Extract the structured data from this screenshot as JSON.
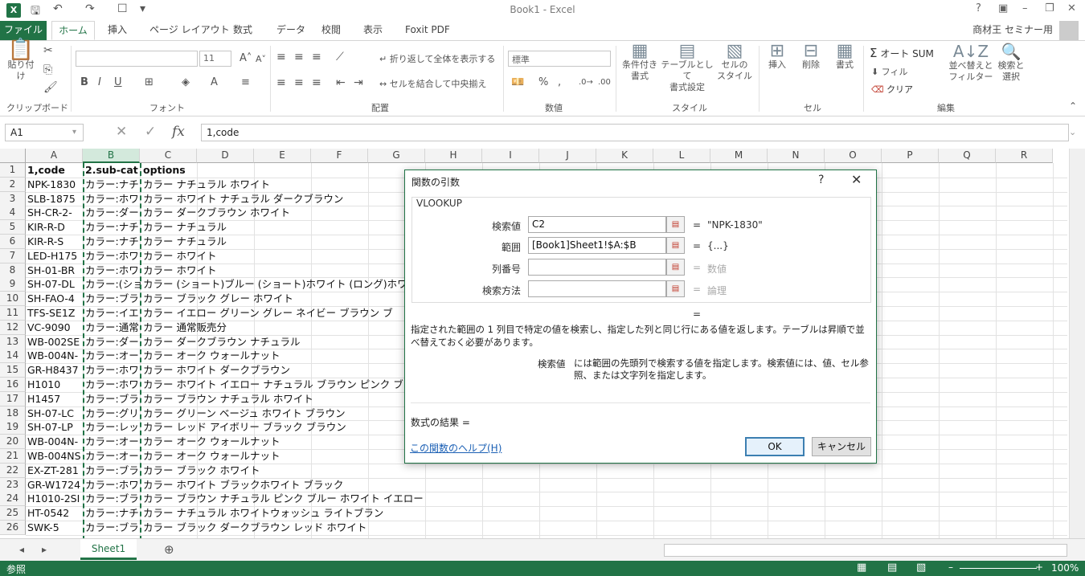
{
  "window": {
    "title": "Book1 - Excel",
    "logo": "X"
  },
  "tabs": [
    "ファイル",
    "ホーム",
    "挿入",
    "ページ レイアウト",
    "数式",
    "データ",
    "校閲",
    "表示",
    "Foxit PDF"
  ],
  "user": "商材王 セミナー用",
  "ribbon": {
    "groups": [
      "クリップボード",
      "フォント",
      "配置",
      "数値",
      "スタイル",
      "セル",
      "編集"
    ],
    "paste": "貼り付け",
    "font_size": "11",
    "wrap_text": "折り返して全体を表示する",
    "merge_center": "セルを結合して中央揃え",
    "number_format": "標準",
    "conditional_format": [
      "条件付き",
      "書式"
    ],
    "format_table": [
      "テーブルとして",
      "書式設定"
    ],
    "cell_styles": [
      "セルの",
      "スタイル"
    ],
    "insert": "挿入",
    "delete": "削除",
    "format": "書式",
    "autosum": "オート SUM",
    "fill": "フィル",
    "clear": "クリア",
    "sort_filter": [
      "並べ替えと",
      "フィルター"
    ],
    "find_select": [
      "検索と",
      "選択"
    ]
  },
  "formula_bar": {
    "name_box": "A1",
    "formula": "1,code"
  },
  "columns": [
    "A",
    "B",
    "C",
    "D",
    "E",
    "F",
    "G",
    "H",
    "I",
    "J",
    "K",
    "L",
    "M",
    "N",
    "O",
    "P",
    "Q",
    "R"
  ],
  "rows": [
    {
      "n": "1",
      "a": "1,code",
      "b": "2.sub-cat",
      "c": "options"
    },
    {
      "n": "2",
      "a": "NPK-1830",
      "b": "カラー:ナチ",
      "c": "カラー ナチュラル ホワイト"
    },
    {
      "n": "3",
      "a": "SLB-1875",
      "b": "カラー:ホワ",
      "c": "カラー ホワイト ナチュラル ダークブラウン"
    },
    {
      "n": "4",
      "a": "SH-CR-2-",
      "b": "カラー:ダー",
      "c": "カラー ダークブラウン ホワイト"
    },
    {
      "n": "5",
      "a": "KIR-R-D",
      "b": "カラー:ナチ",
      "c": "カラー ナチュラル"
    },
    {
      "n": "6",
      "a": "KIR-R-S",
      "b": "カラー:ナチ",
      "c": "カラー ナチュラル"
    },
    {
      "n": "7",
      "a": "LED-H175",
      "b": "カラー:ホワ",
      "c": "カラー ホワイト"
    },
    {
      "n": "8",
      "a": "SH-01-BR",
      "b": "カラー:ホワ",
      "c": "カラー ホワイト"
    },
    {
      "n": "9",
      "a": "SH-07-DL",
      "b": "カラー:(ショ",
      "c": "カラー (ショート)ブルー (ショート)ホワイト (ロング)ホワ"
    },
    {
      "n": "10",
      "a": "SH-FAO-4",
      "b": "カラー:ブラ",
      "c": "カラー ブラック グレー ホワイト"
    },
    {
      "n": "11",
      "a": "TFS-SE1Z",
      "b": "カラー:イエ",
      "c": "カラー イエロー グリーン グレー ネイビー ブラウン ブ"
    },
    {
      "n": "12",
      "a": "VC-9090",
      "b": "カラー:通常",
      "c": "カラー 通常販売分"
    },
    {
      "n": "13",
      "a": "WB-002SE",
      "b": "カラー:ダー",
      "c": "カラー ダークブラウン ナチュラル"
    },
    {
      "n": "14",
      "a": "WB-004N-",
      "b": "カラー:オー",
      "c": "カラー オーク ウォールナット"
    },
    {
      "n": "15",
      "a": "GR-H8437",
      "b": "カラー:ホワ",
      "c": "カラー ホワイト ダークブラウン"
    },
    {
      "n": "16",
      "a": "H1010",
      "b": "カラー:ホワ",
      "c": "カラー ホワイト イエロー ナチュラル ブラウン ピンク ブ"
    },
    {
      "n": "17",
      "a": "H1457",
      "b": "カラー:ブラ",
      "c": "カラー ブラウン ナチュラル ホワイト"
    },
    {
      "n": "18",
      "a": "SH-07-LC",
      "b": "カラー:グリ",
      "c": "カラー グリーン ベージュ ホワイト ブラウン"
    },
    {
      "n": "19",
      "a": "SH-07-LP",
      "b": "カラー:レッ",
      "c": "カラー レッド アイボリー ブラック ブラウン"
    },
    {
      "n": "20",
      "a": "WB-004N-",
      "b": "カラー:オー",
      "c": "カラー オーク ウォールナット"
    },
    {
      "n": "21",
      "a": "WB-004NS",
      "b": "カラー:オー",
      "c": "カラー オーク ウォールナット"
    },
    {
      "n": "22",
      "a": "EX-ZT-281",
      "b": "カラー:ブラ",
      "c": "カラー ブラック ホワイト"
    },
    {
      "n": "23",
      "a": "GR-W1724",
      "b": "カラー:ホワ",
      "c": "カラー ホワイト ブラックホワイト ブラック"
    },
    {
      "n": "24",
      "a": "H1010-2SI",
      "b": "カラー:ブラ",
      "c": "カラー ブラウン ナチュラル ピンク ブルー ホワイト イエロー"
    },
    {
      "n": "25",
      "a": "HT-0542",
      "b": "カラー:ナチ",
      "c": "カラー ナチュラル ホワイトウォッシュ ライトブラン"
    },
    {
      "n": "26",
      "a": "SWK-5",
      "b": "カラー:ブラ",
      "c": "カラー ブラック ダークブラウン レッド ホワイト"
    }
  ],
  "sheet_tab": "Sheet1",
  "status": {
    "mode": "参照",
    "zoom": "100%"
  },
  "dialog": {
    "title": "関数の引数",
    "help_glyph": "?",
    "close_glyph": "✕",
    "function_name": "VLOOKUP",
    "args": [
      {
        "label": "検索値",
        "value": "C2",
        "result": "\"NPK-1830\""
      },
      {
        "label": "範囲",
        "value": "[Book1]Sheet1!$A:$B",
        "result": "{...}"
      },
      {
        "label": "列番号",
        "value": "",
        "result": "数値"
      },
      {
        "label": "検索方法",
        "value": "",
        "result": "論理"
      }
    ],
    "equals": "=",
    "description": "指定された範囲の 1 列目で特定の値を検索し、指定した列と同じ行にある値を返します。テーブルは昇順で並べ替えておく必要があります。",
    "param_name": "検索値",
    "param_description": "には範囲の先頭列で検索する値を指定します。検索値には、値、セル参照、または文字列を指定します。",
    "result_label": "数式の結果 =",
    "help_link": "この関数のヘルプ(H)",
    "ok": "OK",
    "cancel": "キャンセル"
  },
  "colors": {
    "accent": "#217346"
  }
}
